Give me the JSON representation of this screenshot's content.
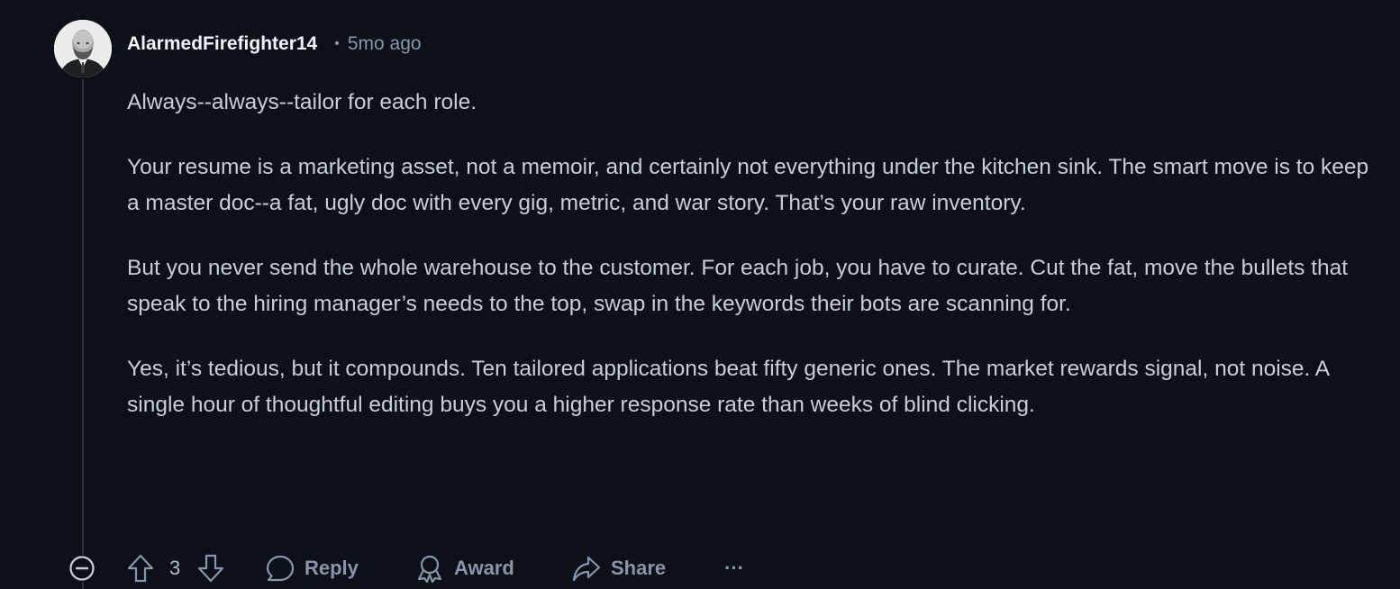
{
  "comment": {
    "author": "AlarmedFirefighter14",
    "separator": "•",
    "age": "5mo ago",
    "paragraphs": [
      "Always--always--tailor for each role.",
      "Your resume is a marketing asset, not a memoir, and certainly not everything under the kitchen sink. The smart move is to keep a master doc--a fat, ugly doc with every gig, metric, and war story. That’s your raw inventory.",
      "But you never send the whole warehouse to the customer. For each job, you have to curate. Cut the fat, move the bullets that speak to the hiring manager’s needs to the top, swap in the keywords their bots are scanning for.",
      "Yes, it’s tedious, but it compounds. Ten tailored applications beat fifty generic ones. The market rewards signal, not noise. A single hour of thoughtful editing buys you a higher response rate than weeks of blind clicking."
    ]
  },
  "actions": {
    "score": "3",
    "reply_label": "Reply",
    "award_label": "Award",
    "share_label": "Share",
    "more_label": "···"
  },
  "icons": {
    "collapse": "collapse-minus-icon",
    "upvote": "arrow-up-icon",
    "downvote": "arrow-down-icon",
    "reply": "speech-bubble-icon",
    "award": "award-ribbon-icon",
    "share": "share-arrow-icon"
  },
  "colors": {
    "background": "#0b1019",
    "text": "#c8ced8",
    "muted": "#8c95a8",
    "username": "#f2f4f8"
  }
}
